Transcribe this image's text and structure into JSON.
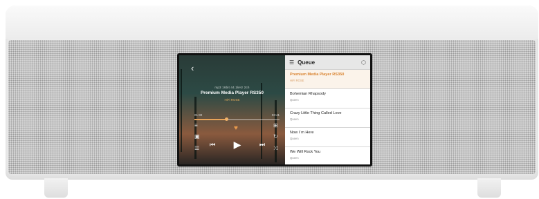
{
  "player": {
    "back_icon": "back-arrow-icon",
    "format": "mp3 16bit 44.1kHz 2ch",
    "song_title": "Premium Media Player RS350",
    "artist": "HiFi ROSE",
    "time_elapsed": "01:30",
    "time_total": "03:41",
    "progress": 0.38,
    "accent_color": "#e8a45a",
    "controls": {
      "previous": "⏮",
      "play": "▶",
      "next": "⏭"
    }
  },
  "queue": {
    "title": "Queue",
    "items": [
      {
        "title": "Premium Media Player RS350",
        "artist": "HiFi ROSE",
        "current": true
      },
      {
        "title": "Bohemian Rhapsody",
        "artist": "Queen",
        "current": false
      },
      {
        "title": "Crazy Little Thing Called Love",
        "artist": "Queen",
        "current": false
      },
      {
        "title": "Now I`m Here",
        "artist": "Queen",
        "current": false
      },
      {
        "title": "We Will Rock You",
        "artist": "Queen",
        "current": false
      }
    ]
  }
}
